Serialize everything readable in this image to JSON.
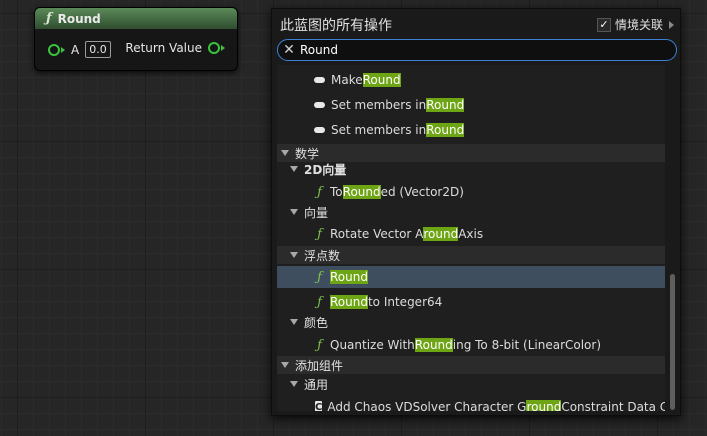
{
  "node": {
    "title": "Round",
    "input_label": "A",
    "input_value": "0.0",
    "output_label": "Return Value"
  },
  "menu": {
    "title": "此蓝图的所有操作",
    "context_label": "情境关联",
    "context_checked": true,
    "search_value": "Round"
  },
  "rows": [
    {
      "kind": "item",
      "icon": "pill",
      "segments": [
        "Make ",
        "Round"
      ]
    },
    {
      "kind": "item",
      "icon": "pill",
      "segments": [
        "Set members in ",
        "Round"
      ]
    },
    {
      "kind": "item",
      "icon": "pill",
      "segments": [
        "Set members in ",
        "Round"
      ]
    },
    {
      "kind": "category",
      "label": "数学"
    },
    {
      "kind": "subcategory",
      "label": "2D向量"
    },
    {
      "kind": "item",
      "icon": "function",
      "segments": [
        "To ",
        "Round",
        "ed (Vector2D)"
      ]
    },
    {
      "kind": "subcategory",
      "label": "向量"
    },
    {
      "kind": "item",
      "icon": "function",
      "segments": [
        "Rotate Vector A",
        "round",
        " Axis"
      ]
    },
    {
      "kind": "subcategory",
      "label": "浮点数"
    },
    {
      "kind": "item",
      "icon": "function",
      "segments": [
        "",
        "Round"
      ],
      "selected": true
    },
    {
      "kind": "item",
      "icon": "function",
      "segments": [
        "",
        "Round",
        " to Integer64"
      ]
    },
    {
      "kind": "subcategory",
      "label": "颜色"
    },
    {
      "kind": "item",
      "icon": "function",
      "segments": [
        "Quantize With ",
        "Round",
        "ing To 8-bit (LinearColor)"
      ]
    },
    {
      "kind": "category",
      "label": "添加组件"
    },
    {
      "kind": "subcategory",
      "label": "通用"
    },
    {
      "kind": "item",
      "icon": "component",
      "icon_letter": "C",
      "segments": [
        "Add Chaos VDSolver Character G",
        "round",
        " Constraint Data Co"
      ]
    }
  ],
  "colors": {
    "node_header": "#4f7a4e",
    "pin": "#38c43c",
    "highlight": "#6ea514",
    "selected_row": "#3e4e5f",
    "search_border": "#3b82d6"
  },
  "icons": {
    "function": "function-icon",
    "pill": "struct-member-icon",
    "component": "component-icon",
    "clear": "close-icon",
    "checkbox": "checkmark-icon"
  }
}
